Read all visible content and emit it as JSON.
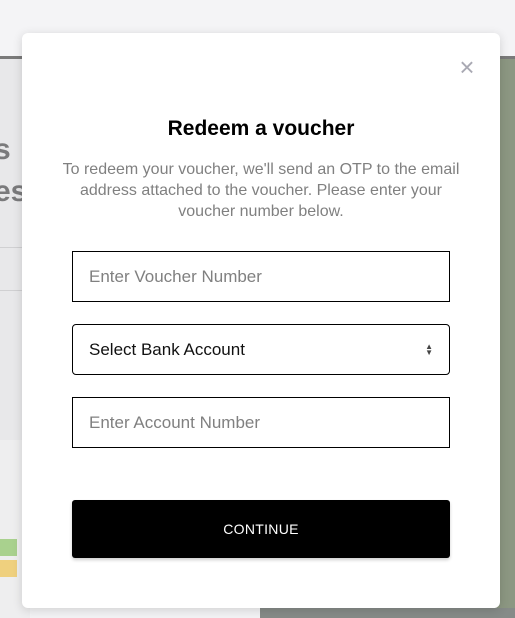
{
  "modal": {
    "title": "Redeem a voucher",
    "description": "To redeem your voucher, we'll send an OTP to the email address attached to the voucher. Please enter your voucher number below.",
    "voucher_placeholder": "Enter Voucher Number",
    "voucher_value": "",
    "bank_select_value": "Select Bank Account",
    "account_placeholder": "Enter Account Number",
    "account_value": "",
    "continue_label": "CONTINUE",
    "close_icon": "close-icon"
  },
  "background": {
    "partial_text_1": "s",
    "partial_text_2": "es"
  },
  "colors": {
    "button": "#000000",
    "description": "#808080",
    "close": "#a9a9b3"
  }
}
